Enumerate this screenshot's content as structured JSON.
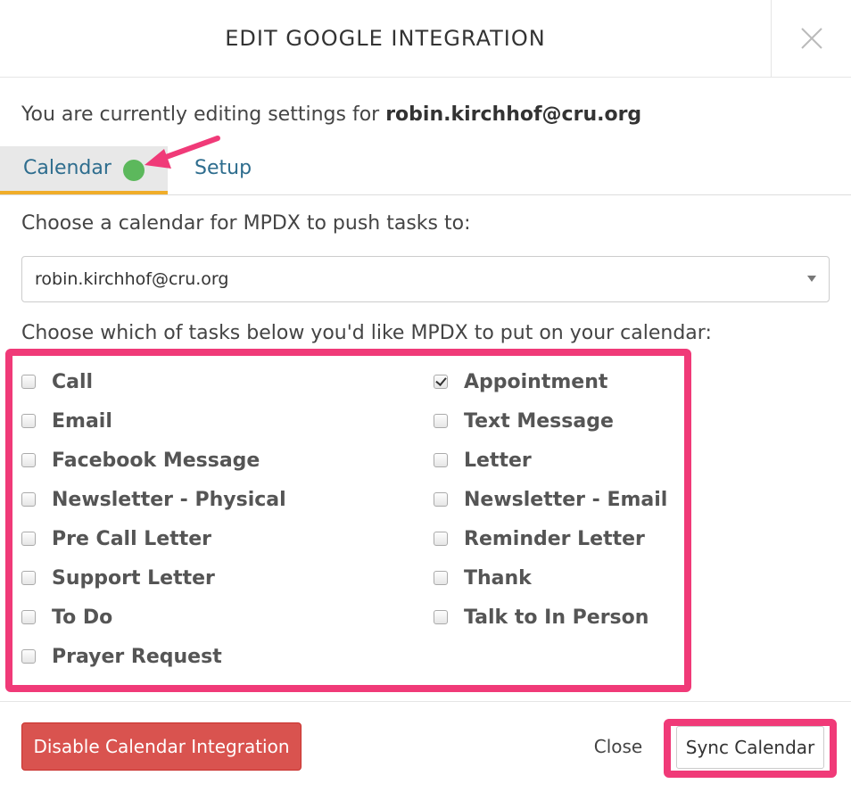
{
  "modal": {
    "title": "EDIT GOOGLE INTEGRATION",
    "close_icon": "close-x-icon"
  },
  "editing": {
    "prefix": "You are currently editing settings for ",
    "account": "robin.kirchhof@cru.org"
  },
  "tabs": [
    {
      "label": "Calendar",
      "active": true,
      "status": "connected",
      "status_color": "#5cb85c"
    },
    {
      "label": "Setup",
      "active": false
    }
  ],
  "calendar": {
    "choose_label": "Choose a calendar for MPDX to push tasks to:",
    "selected": "robin.kirchhof@cru.org"
  },
  "tasks": {
    "label": "Choose which of tasks below you'd like MPDX to put on your calendar:",
    "left": [
      {
        "label": "Call",
        "checked": false
      },
      {
        "label": "Email",
        "checked": false
      },
      {
        "label": "Facebook Message",
        "checked": false
      },
      {
        "label": "Newsletter - Physical",
        "checked": false
      },
      {
        "label": "Pre Call Letter",
        "checked": false
      },
      {
        "label": "Support Letter",
        "checked": false
      },
      {
        "label": "To Do",
        "checked": false
      },
      {
        "label": "Prayer Request",
        "checked": false
      }
    ],
    "right": [
      {
        "label": "Appointment",
        "checked": true
      },
      {
        "label": "Text Message",
        "checked": false
      },
      {
        "label": "Letter",
        "checked": false
      },
      {
        "label": "Newsletter - Email",
        "checked": false
      },
      {
        "label": "Reminder Letter",
        "checked": false
      },
      {
        "label": "Thank",
        "checked": false
      },
      {
        "label": "Talk to In Person",
        "checked": false
      }
    ]
  },
  "footer": {
    "disable_label": "Disable Calendar Integration",
    "close_label": "Close",
    "sync_label": "Sync Calendar"
  },
  "colors": {
    "accent_highlight": "#f03a78",
    "danger": "#d9534f",
    "link": "#2e6d8e",
    "tab_underline": "#f0ad2a"
  }
}
